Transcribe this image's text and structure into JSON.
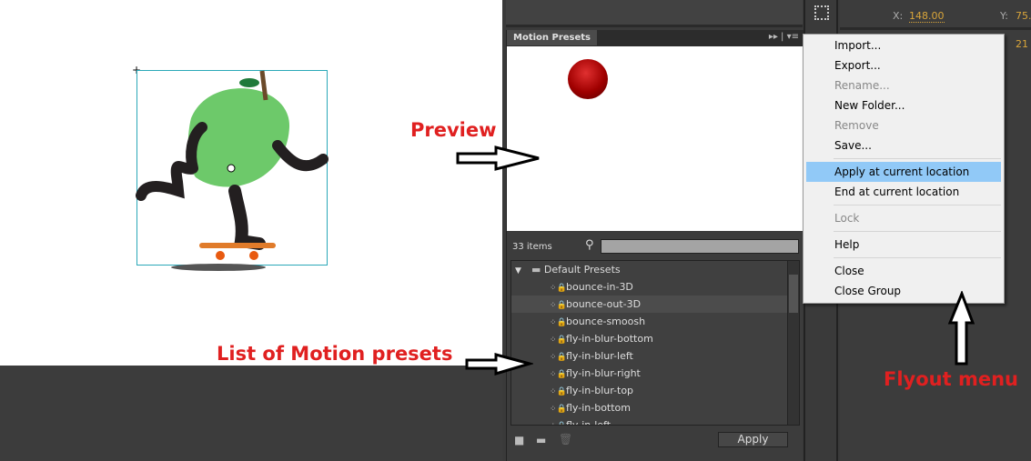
{
  "properties": {
    "x_label": "X:",
    "x_value": "148.00",
    "y_label": "Y:",
    "y_value": "75.",
    "w_value": "21"
  },
  "panel": {
    "title": "Motion Presets",
    "item_count": "33 items",
    "search_value": "",
    "apply_label": "Apply",
    "folder": "Default Presets",
    "presets": [
      "bounce-in-3D",
      "bounce-out-3D",
      "bounce-smoosh",
      "fly-in-blur-bottom",
      "fly-in-blur-left",
      "fly-in-blur-right",
      "fly-in-blur-top",
      "fly-in-bottom",
      "fly-in-left"
    ]
  },
  "menu": {
    "items": [
      {
        "label": "Import...",
        "enabled": true
      },
      {
        "label": "Export...",
        "enabled": true
      },
      {
        "label": "Rename...",
        "enabled": false
      },
      {
        "label": "New Folder...",
        "enabled": true
      },
      {
        "label": "Remove",
        "enabled": false
      },
      {
        "label": "Save...",
        "enabled": true
      },
      {
        "label": "Apply at current location",
        "enabled": true
      },
      {
        "label": "End at current location",
        "enabled": true
      },
      {
        "label": "Lock",
        "enabled": false
      },
      {
        "label": "Help",
        "enabled": true
      },
      {
        "label": "Close",
        "enabled": true
      },
      {
        "label": "Close Group",
        "enabled": true
      }
    ]
  },
  "annotations": {
    "preview": "Preview",
    "list": "List of Motion presets",
    "flyout": "Flyout menu"
  },
  "colors": {
    "annotation": "#e02020",
    "highlight": "#91c9f7",
    "value": "#d9a53a"
  }
}
